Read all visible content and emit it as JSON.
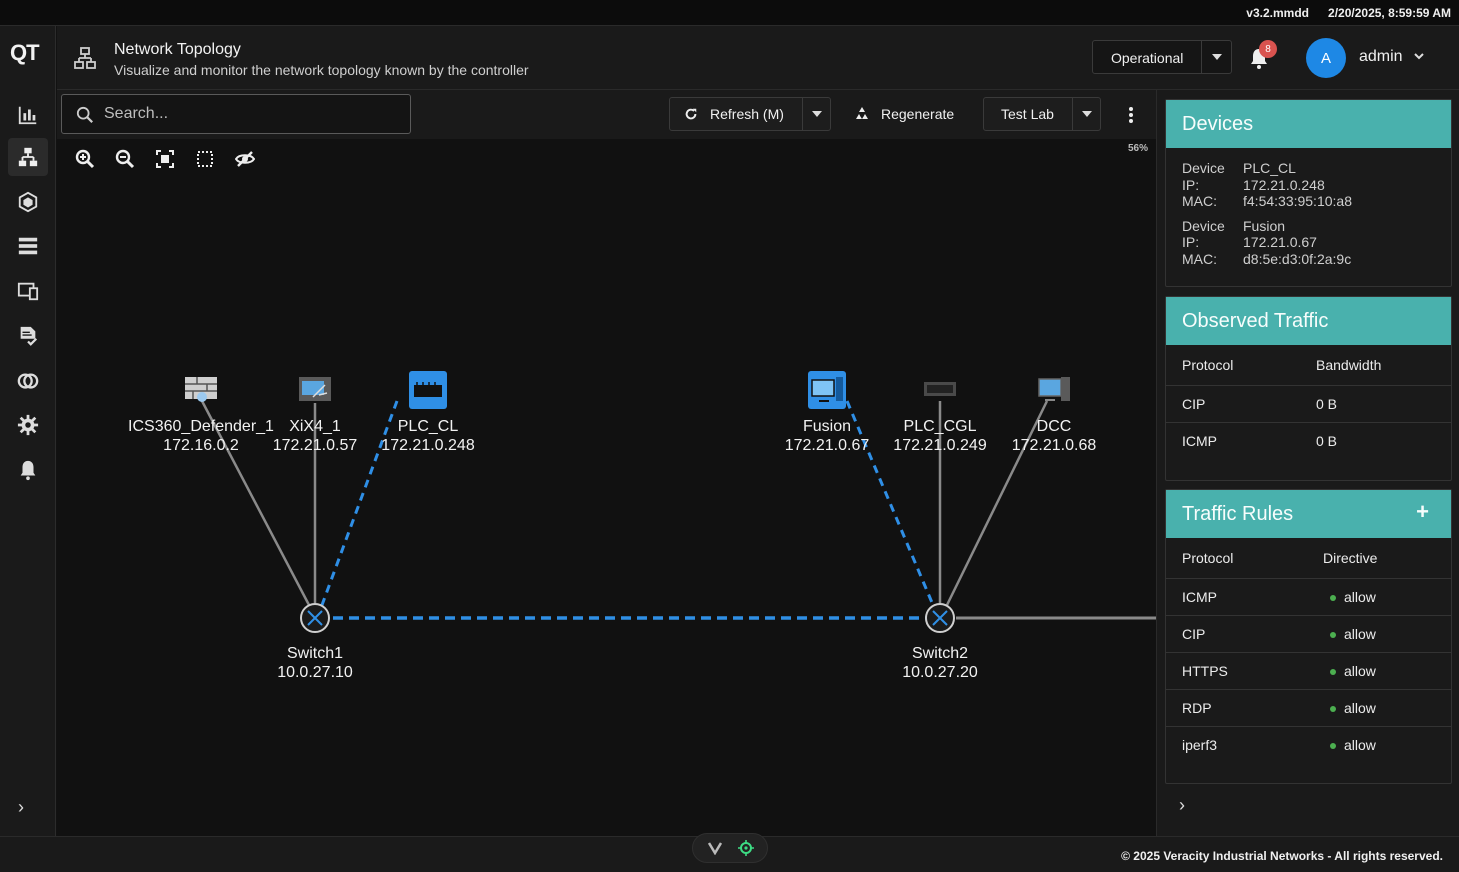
{
  "status_bar": {
    "version": "v3.2.mmdd",
    "timestamp": "2/20/2025, 8:59:59 AM"
  },
  "brand": {
    "logo_text": "QT"
  },
  "sidebar": {
    "items": [
      {
        "name": "dashboard",
        "icon": "bar-chart-icon"
      },
      {
        "name": "topology",
        "icon": "network-icon",
        "active": true
      },
      {
        "name": "assets",
        "icon": "cube-icon"
      },
      {
        "name": "devices",
        "icon": "server-list-icon"
      },
      {
        "name": "endpoints",
        "icon": "devices-icon"
      },
      {
        "name": "policies",
        "icon": "document-check-icon"
      },
      {
        "name": "zones",
        "icon": "overlap-circles-icon"
      },
      {
        "name": "settings",
        "icon": "gear-icon"
      },
      {
        "name": "alerts",
        "icon": "bell-icon"
      }
    ],
    "expand_glyph": "›"
  },
  "header": {
    "title": "Network Topology",
    "subtitle": "Visualize and monitor the network topology known by the controller",
    "mode": "Operational",
    "notifications_count": "8",
    "avatar_initial": "A",
    "username": "admin"
  },
  "toolbar": {
    "search_placeholder": "Search...",
    "refresh_label": "Refresh (M)",
    "regenerate_label": "Regenerate",
    "lab_label": "Test Lab"
  },
  "canvas": {
    "zoom": "56%",
    "nodes": [
      {
        "id": "ics360",
        "name": "ICS360_Defender_1",
        "ip": "172.16.0.2",
        "icon": "firewall-icon"
      },
      {
        "id": "xix4",
        "name": "XiX4_1",
        "ip": "172.21.0.57",
        "icon": "workstation-tools-icon"
      },
      {
        "id": "plc_cl",
        "name": "PLC_CL",
        "ip": "172.21.0.248",
        "icon": "plc-icon",
        "selected": true
      },
      {
        "id": "fusion",
        "name": "Fusion",
        "ip": "172.21.0.67",
        "icon": "computer-icon",
        "selected": true
      },
      {
        "id": "plc_cgl",
        "name": "PLC_CGL",
        "ip": "172.21.0.249",
        "icon": "plc-icon"
      },
      {
        "id": "dcc",
        "name": "DCC",
        "ip": "172.21.0.68",
        "icon": "computer-icon"
      },
      {
        "id": "switch1",
        "name": "Switch1",
        "ip": "10.0.27.10",
        "icon": "switch-icon"
      },
      {
        "id": "switch2",
        "name": "Switch2",
        "ip": "10.0.27.20",
        "icon": "switch-icon"
      }
    ],
    "highlight_color": "#2f8fe6",
    "link_color": "#8a8a8a"
  },
  "devices_panel": {
    "title": "Devices",
    "entries": [
      {
        "device_label": "Device",
        "device": "PLC_CL",
        "ip_label": "IP:",
        "ip": "172.21.0.248",
        "mac_label": "MAC:",
        "mac": "f4:54:33:95:10:a8"
      },
      {
        "device_label": "Device",
        "device": "Fusion",
        "ip_label": "IP:",
        "ip": "172.21.0.67",
        "mac_label": "MAC:",
        "mac": "d8:5e:d3:0f:2a:9c"
      }
    ]
  },
  "traffic_panel": {
    "title": "Observed Traffic",
    "columns": [
      "Protocol",
      "Bandwidth"
    ],
    "rows": [
      {
        "protocol": "CIP",
        "bandwidth": "0 B"
      },
      {
        "protocol": "ICMP",
        "bandwidth": "0 B"
      }
    ]
  },
  "rules_panel": {
    "title": "Traffic Rules",
    "add_glyph": "+",
    "columns": [
      "Protocol",
      "Directive"
    ],
    "rows": [
      {
        "protocol": "ICMP",
        "directive": "allow"
      },
      {
        "protocol": "CIP",
        "directive": "allow"
      },
      {
        "protocol": "HTTPS",
        "directive": "allow"
      },
      {
        "protocol": "RDP",
        "directive": "allow"
      },
      {
        "protocol": "iperf3",
        "directive": "allow"
      }
    ],
    "status_color": "#4caf50"
  },
  "footer": {
    "copyright": "© 2025 Veracity Industrial Networks - All rights reserved."
  },
  "theme": {
    "accent": "#49b1ad",
    "primary": "#1e88e5",
    "badge": "#d9534f"
  }
}
